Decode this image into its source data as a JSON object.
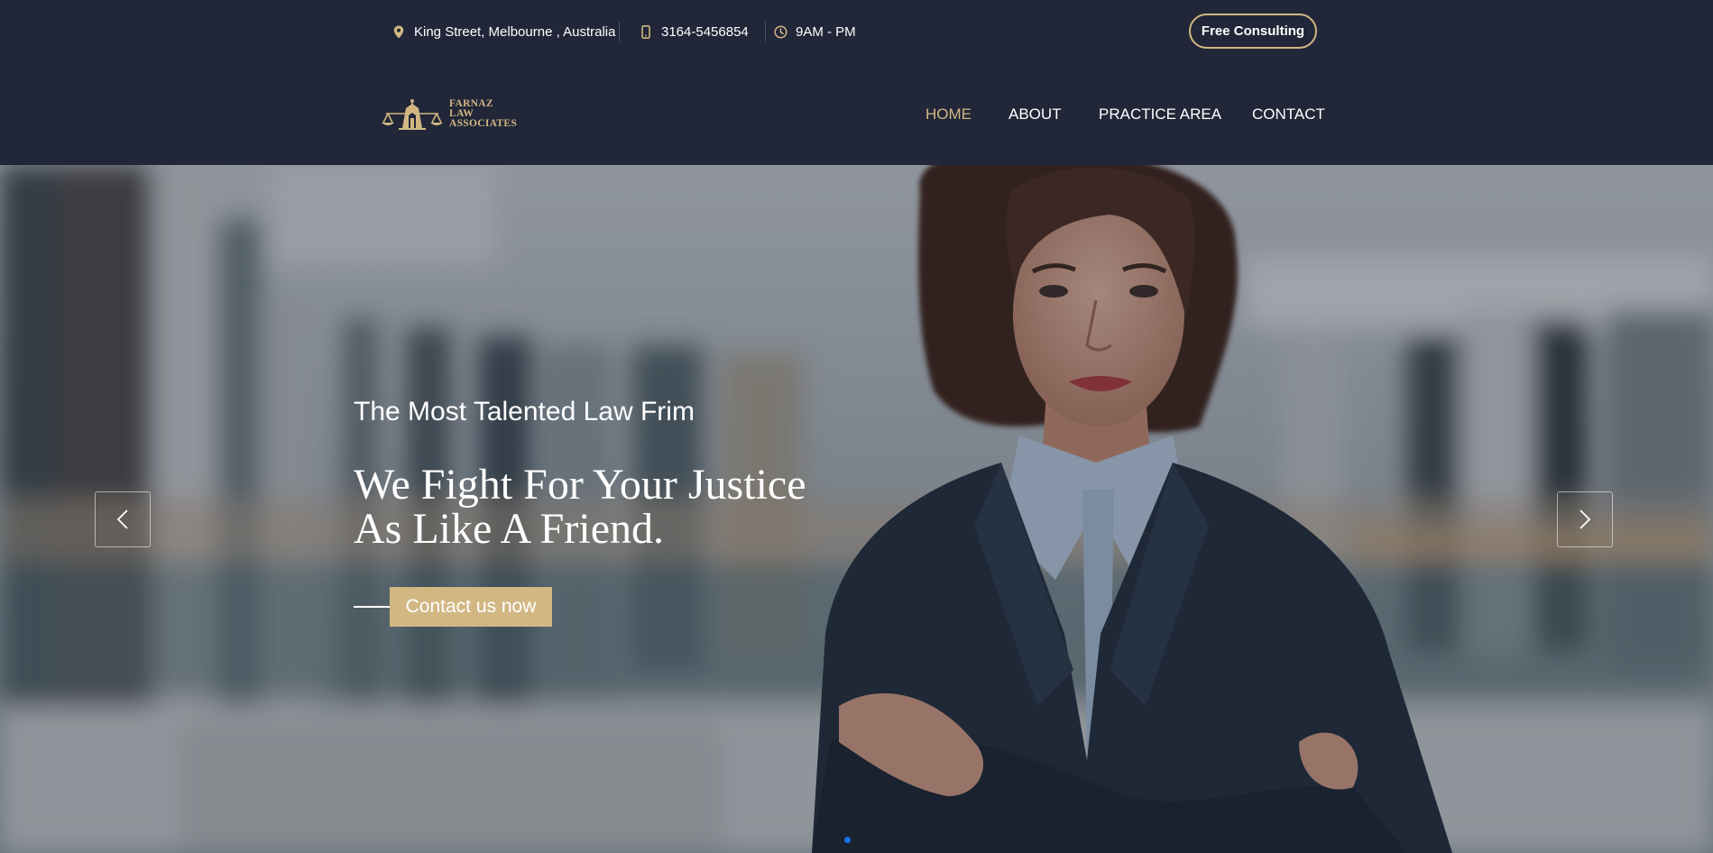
{
  "topbar": {
    "address": "King Street, Melbourne , Australia",
    "phone": "3164-5456854",
    "hours": "9AM - PM",
    "consult_button": "Free Consulting",
    "icons": {
      "address": "location-pin-icon",
      "phone": "mobile-phone-icon",
      "hours": "clock-icon"
    }
  },
  "brand": {
    "logo_line1": "FARNAZ",
    "logo_line2": "LAW",
    "logo_line3": "ASSOCIATES"
  },
  "nav": {
    "items": [
      {
        "label": "HOME",
        "active": true
      },
      {
        "label": "ABOUT",
        "active": false
      },
      {
        "label": "PRACTICE AREA",
        "active": false
      },
      {
        "label": "CONTACT",
        "active": false
      }
    ]
  },
  "hero": {
    "subtitle": "The Most Talented Law Frim",
    "title_line1": "We Fight For Your Justice",
    "title_line2": "As Like A Friend.",
    "cta": "Contact us now",
    "slide_count": 1,
    "active_slide": 1
  },
  "colors": {
    "background": "#212738",
    "accent": "#d2b783",
    "text": "#ffffff",
    "dot_active": "#1a73e8"
  }
}
